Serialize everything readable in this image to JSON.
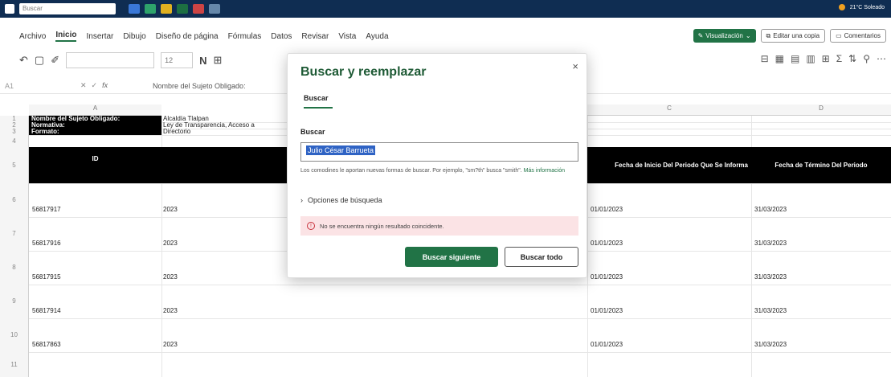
{
  "taskbar": {
    "search_placeholder": "Buscar",
    "right_status": "21°C Soleado"
  },
  "menu": {
    "tabs": [
      "Archivo",
      "Inicio",
      "Insertar",
      "Dibujo",
      "Diseño de página",
      "Fórmulas",
      "Datos",
      "Revisar",
      "Vista",
      "Ayuda"
    ],
    "active": "Inicio"
  },
  "ribbon_buttons": {
    "view": "Visualización",
    "edit_copy": "Editar una copia",
    "comments": "Comentarios"
  },
  "toolbar": {
    "font_size": "12",
    "bold": "N"
  },
  "formula_bar": {
    "name_box": "A1",
    "content": "Nombre del Sujeto Obligado:"
  },
  "sheet": {
    "columns": [
      "A",
      "C",
      "D"
    ],
    "rows_numbers": [
      "1",
      "2",
      "3",
      "4",
      "5",
      "6",
      "7",
      "8",
      "9",
      "10",
      "11"
    ],
    "meta": [
      {
        "label": "Nombre del Sujeto Obligado:",
        "value": "Alcaldía Tlalpan"
      },
      {
        "label": "Normativa:",
        "value": "Ley de Transparencia, Acceso a"
      },
      {
        "label": "Formato:",
        "value": "Directorio"
      }
    ],
    "headers": {
      "id": "ID",
      "c": "Fecha de Inicio Del Periodo Que Se Informa",
      "d": "Fecha de Término Del Periodo"
    },
    "data_rows": [
      {
        "id": "56817917",
        "b": "2023",
        "c": "01/01/2023",
        "d": "31/03/2023"
      },
      {
        "id": "56817916",
        "b": "2023",
        "c": "01/01/2023",
        "d": "31/03/2023"
      },
      {
        "id": "56817915",
        "b": "2023",
        "c": "01/01/2023",
        "d": "31/03/2023"
      },
      {
        "id": "56817914",
        "b": "2023",
        "c": "01/01/2023",
        "d": "31/03/2023"
      },
      {
        "id": "56817863",
        "b": "2023",
        "c": "01/01/2023",
        "d": "31/03/2023"
      }
    ]
  },
  "dialog": {
    "title": "Buscar y reemplazar",
    "close": "×",
    "tab": "Buscar",
    "field_label": "Buscar",
    "field_value": "Julio César Barrueta",
    "hint": "Los comodines le aportan nuevas formas de buscar. Por ejemplo, \"sm?th\" busca \"smith\".",
    "hint_link": "Más información",
    "options": "Opciones de búsqueda",
    "error": "No se encuentra ningún resultado coincidente.",
    "btn_next": "Buscar siguiente",
    "btn_all": "Buscar todo"
  },
  "colors": {
    "accent": "#217346",
    "taskbar": "#0f2d52",
    "error_bg": "#fbe3e5"
  }
}
